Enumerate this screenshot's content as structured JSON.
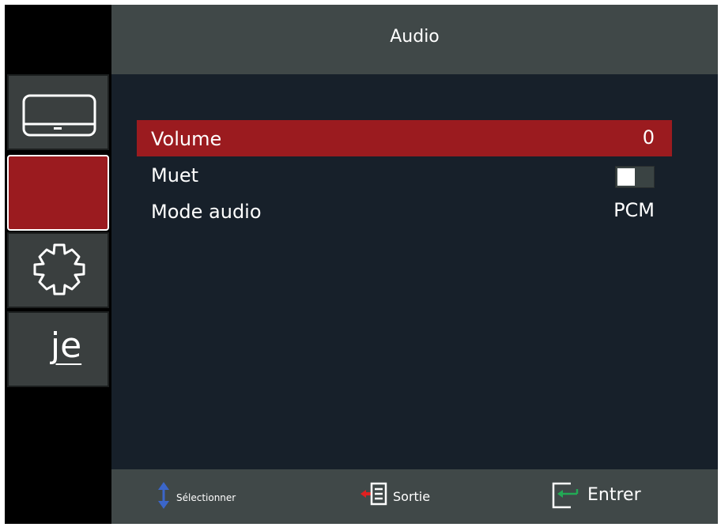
{
  "header": {
    "title": "Audio"
  },
  "sidebar": {
    "tabs": [
      {
        "name": "image-tab",
        "icon": "monitor-icon"
      },
      {
        "name": "audio-tab",
        "icon": "speaker-icon",
        "active": true
      },
      {
        "name": "settings-tab",
        "icon": "gear-icon"
      },
      {
        "name": "language-tab",
        "text": "je"
      }
    ]
  },
  "menu": {
    "items": [
      {
        "label": "Volume",
        "value": "0",
        "selected": true
      },
      {
        "label": "Muet",
        "toggle_on": false
      },
      {
        "label": "Mode audio",
        "value": "PCM"
      }
    ]
  },
  "footer": {
    "select_label": "Sélectionner",
    "exit_label": "Sortie",
    "enter_label": "Entrer"
  },
  "colors": {
    "accent": "#9b1b1f",
    "header_bg": "#404848",
    "content_bg": "#17202a",
    "select_icon": "#3b66c9",
    "exit_icon": "#e02020",
    "enter_icon": "#22aa55"
  }
}
